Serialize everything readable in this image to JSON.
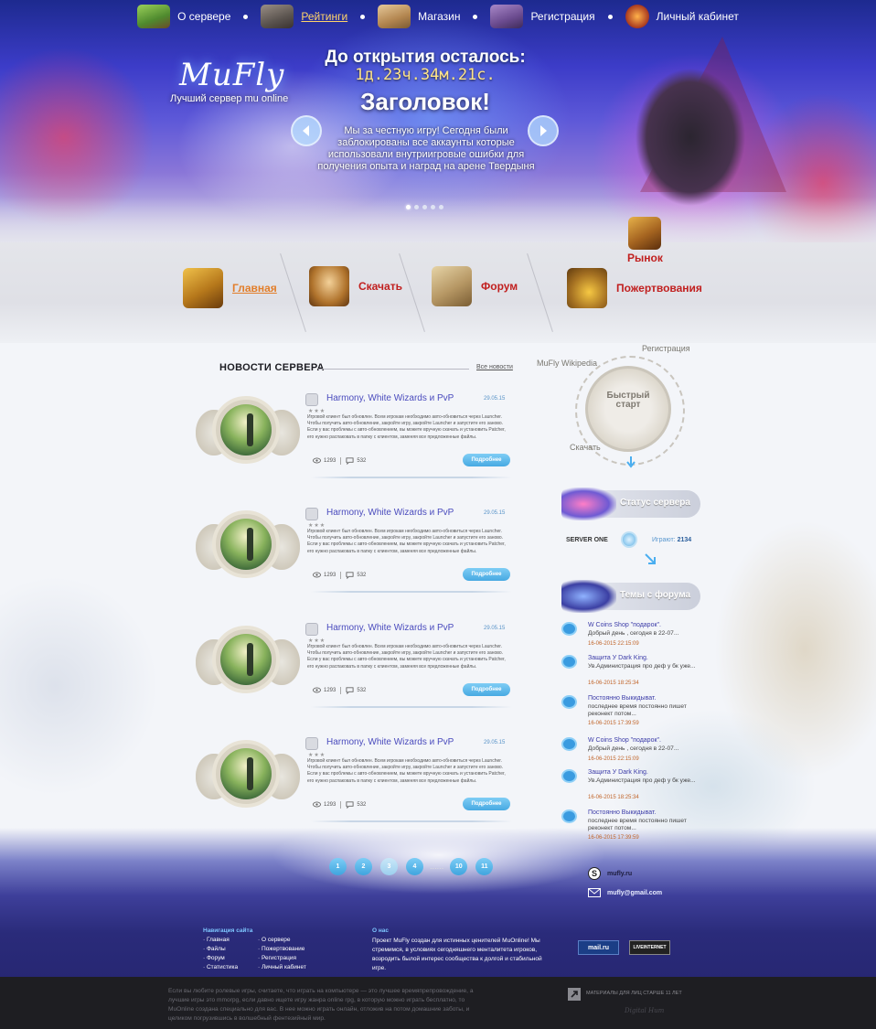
{
  "colors": {
    "accent_blue": "#47a9e2",
    "menu_red": "#c1201f",
    "menu_active": "#e27e2a",
    "topnav_active": "#ffd36a",
    "link_purple": "#4a4bbd",
    "footer_bg": "#1e1e22"
  },
  "topnav": {
    "items": [
      {
        "label": "О сервере",
        "icon": "grass-block-icon"
      },
      {
        "label": "Рейтинги",
        "icon": "castle-icon",
        "active": true
      },
      {
        "label": "Магазин",
        "icon": "log-icon"
      },
      {
        "label": "Регистрация",
        "icon": "chest-icon"
      },
      {
        "label": "Личный кабинет",
        "icon": "shield-emblem-icon"
      }
    ]
  },
  "hero": {
    "logo": "MuFly",
    "tagline": "Лучший сервер mu online",
    "countdown_title": "До открытия осталось:",
    "countdown_value": "1д.23ч.34м.21с.",
    "heading": "Заголовок!",
    "text": "Мы за честную игру! Сегодня были заблокированы все аккаунты которые использовали внутриигровые ошибки для получения опыта и наград на арене Твердыня",
    "slides_total": 5,
    "slide_active": 1
  },
  "mainmenu": {
    "items": [
      {
        "label": "Главная",
        "icon": "spellbook-icon",
        "active": true
      },
      {
        "label": "Скачать",
        "icon": "hourglass-icon"
      },
      {
        "label": "Форум",
        "icon": "map-scroll-icon"
      },
      {
        "label": "Рынок",
        "icon": "treasure-chest-icon"
      },
      {
        "label": "Пожертвования",
        "icon": "gold-bag-icon"
      }
    ]
  },
  "news": {
    "title": "НОВОСТИ СЕРВЕРА",
    "all_link": "Все новости",
    "posts": [
      {
        "title": "Harmony, White Wizards и PvP",
        "date": "29.05.15",
        "stars": "★★★",
        "text": "Игровой клиент был обновлен. Всем игрокам необходимо авто-обновиться через Launcher. Чтобы получить авто-обновление, закройте игру, закройте Launcher и запустите его заново. Если у вас проблемы с авто-обновлением, вы можете вручную скачать и установить Patcher, его нужно распаковать в папку с клиентом, заменяя все предложенные файлы.",
        "views": "1293",
        "comments": "532",
        "button": "Подробнее"
      },
      {
        "title": "Harmony, White Wizards и PvP",
        "date": "29.05.15",
        "stars": "★★★",
        "text": "Игровой клиент был обновлен. Всем игрокам необходимо авто-обновиться через Launcher. Чтобы получить авто-обновление, закройте игру, закройте Launcher и запустите его заново. Если у вас проблемы с авто-обновлением, вы можете вручную скачать и установить Patcher, его нужно распаковать в папку с клиентом, заменяя все предложенные файлы.",
        "views": "1293",
        "comments": "532",
        "button": "Подробнее"
      },
      {
        "title": "Harmony, White Wizards и PvP",
        "date": "29.05.15",
        "stars": "★★★",
        "text": "Игровой клиент был обновлен. Всем игрокам необходимо авто-обновиться через Launcher. Чтобы получить авто-обновление, закройте игру, закройте Launcher и запустите его заново. Если у вас проблемы с авто-обновлением, вы можете вручную скачать и установить Patcher, его нужно распаковать в папку с клиентом, заменяя все предложенные файлы.",
        "views": "1293",
        "comments": "532",
        "button": "Подробнее"
      },
      {
        "title": "Harmony, White Wizards и PvP",
        "date": "29.05.15",
        "stars": "★★★",
        "text": "Игровой клиент был обновлен. Всем игрокам необходимо авто-обновиться через Launcher. Чтобы получить авто-обновление, закройте игру, закройте Launcher и запустите его заново. Если у вас проблемы с авто-обновлением, вы можете вручную скачать и установить Patcher, его нужно распаковать в папку с клиентом, заменяя все предложенные файлы.",
        "views": "1293",
        "comments": "532",
        "button": "Подробнее"
      }
    ]
  },
  "pager": {
    "pages": [
      "1",
      "2",
      "3",
      "4",
      "10",
      "11"
    ],
    "current": "3",
    "ellipsis": "......"
  },
  "quickstart": {
    "title": "Быстрый старт",
    "wiki": "MuFly Wikipedia",
    "register": "Регистрация",
    "download": "Скачать"
  },
  "server_status": {
    "title": "Статус сервера",
    "server_name": "SERVER ONE",
    "playing_label": "Играют:",
    "playing_count": "2134"
  },
  "forum": {
    "title": "Темы с форума",
    "topics": [
      {
        "title": "W Coins Shop \"подарок\".",
        "text": "Добрый день , сегодня в 22-07...",
        "date": "16-06-2015 22:15:09"
      },
      {
        "title": "Защита У Dark King.",
        "text": "Ув.Администрация про деф у бк уже...",
        "date": "16-06-2015 18:25:34"
      },
      {
        "title": "Постоянно Выкидыват.",
        "text": "последнее время постоянно пишет реконект потом...",
        "date": "16-06-2015 17:39:59"
      },
      {
        "title": "W Coins Shop \"подарок\".",
        "text": "Добрый день , сегодня в 22-07...",
        "date": "16-06-2015 22:15:09"
      },
      {
        "title": "Защита У Dark King.",
        "text": "Ув.Администрация про деф у бк уже...",
        "date": "16-06-2015 18:25:34"
      },
      {
        "title": "Постоянно Выкидыват.",
        "text": "последнее время постоянно пишет реконект потом...",
        "date": "16-06-2015 17:39:59"
      }
    ]
  },
  "contacts": {
    "skype": "mufly.ru",
    "email": "mufly@gmail.com"
  },
  "footer": {
    "nav_title": "Навигация сайта",
    "nav_col1": [
      "· Главная",
      "· Файлы",
      "· Форум",
      "· Статистика"
    ],
    "nav_col2": [
      "· О сервере",
      "· Пожертвование",
      "· Регистрация",
      "· Личный кабинет"
    ],
    "about_title": "О нас",
    "about_text": "Проект MuFly создан для истинных ценителей MuOnline! Мы стремимся, в условиях сегодняшнего менталитета игроков, возродить былой интерес сообщества к долгой и стабильной игре.",
    "badge_mail": "mail.ru",
    "badge_lvi": "LIVEINTERNET",
    "bottom_text": "Если вы любите ролевые игры, считаете, что играть на компьютере — это лучшее времяпрепровождение, а лучшие игры это mmorpg, если давно ищете игру жанра online rpg, в которую можно играть бесплатно, то MuOnline создана специально для вас. В нее можно играть онлайн, отложив на потом домашние заботы, и целиком погрузившись в волшебный фентезийный мир.",
    "age_text": "МАТЕРИАЛЫ ДЛЯ ЛИЦ СТАРШЕ 11 ЛЕТ",
    "developer": "Digital Hum"
  }
}
